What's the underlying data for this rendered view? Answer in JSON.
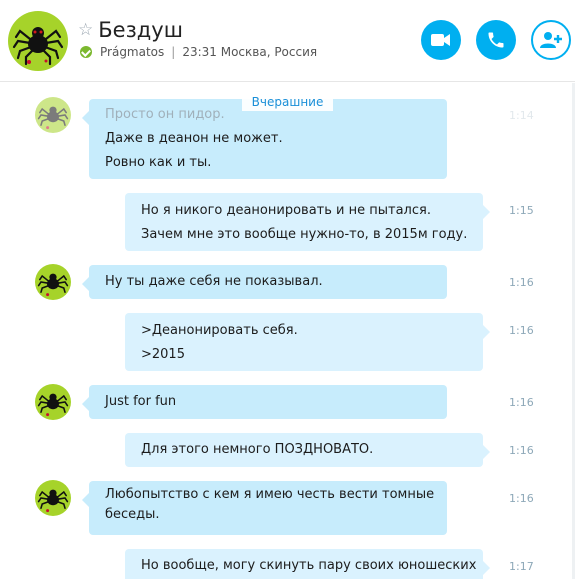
{
  "header": {
    "contact_name": "Бездуш",
    "status_user": "Prágmatos",
    "status_separator": "|",
    "status_location": "23:31 Москва, Россия",
    "accent_color": "#00aff0",
    "presence_color": "#7cb82f",
    "buttons": {
      "video": "video-call",
      "call": "audio-call",
      "add": "add-participant"
    }
  },
  "chat": {
    "date_divider": "Вчерашние",
    "messages": [
      {
        "direction": "in",
        "lines": [
          "Просто он пидор.",
          "Даже в деанон не может.",
          "Ровно как и ты."
        ],
        "time": "1:14"
      },
      {
        "direction": "out",
        "lines": [
          "Но я никого деанонировать и не пытался.",
          "Зачем мне это вообще нужно-то, в 2015м году."
        ],
        "time": "1:15"
      },
      {
        "direction": "in",
        "lines": [
          "Ну ты даже себя не показывал."
        ],
        "time": "1:16"
      },
      {
        "direction": "out",
        "lines": [
          ">Деанонировать себя.",
          ">2015"
        ],
        "time": "1:16"
      },
      {
        "direction": "in",
        "lines": [
          "Just for fun"
        ],
        "time": "1:16"
      },
      {
        "direction": "out",
        "lines": [
          "Для этого немного ПОЗДНОВАТО."
        ],
        "time": "1:16"
      },
      {
        "direction": "in",
        "lines": [
          "Любопытство с кем я имею честь вести томные",
          "беседы."
        ],
        "time": "1:16"
      },
      {
        "direction": "out",
        "lines": [
          "Но вообще, могу скинуть пару своих юношеских"
        ],
        "time": "1:17"
      }
    ]
  },
  "colors": {
    "bubble_in": "#c7ecfc",
    "bubble_out": "#daf2fe",
    "avatar_bg": "#a6d32a",
    "time_text": "#8da8b8"
  }
}
